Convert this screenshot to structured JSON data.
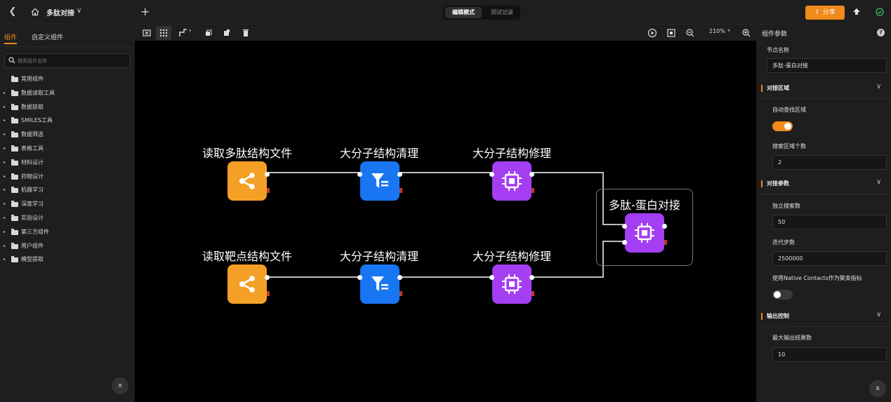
{
  "header": {
    "project_name": "多肽对接",
    "mode_tabs": [
      "编辑模式",
      "测试记录"
    ],
    "share_label": "分享"
  },
  "sidebar": {
    "tabs": [
      "组件",
      "自定义组件"
    ],
    "search_placeholder": "搜索组件名称",
    "items": [
      {
        "label": "常用组件",
        "expandable": false
      },
      {
        "label": "数据读取工具",
        "expandable": true
      },
      {
        "label": "数据获取",
        "expandable": true
      },
      {
        "label": "SMILES工具",
        "expandable": true
      },
      {
        "label": "数据筛选",
        "expandable": true
      },
      {
        "label": "表格工具",
        "expandable": true
      },
      {
        "label": "材料设计",
        "expandable": true
      },
      {
        "label": "药物设计",
        "expandable": true
      },
      {
        "label": "机器学习",
        "expandable": true
      },
      {
        "label": "深度学习",
        "expandable": true
      },
      {
        "label": "实验设计",
        "expandable": true
      },
      {
        "label": "第三方组件",
        "expandable": true
      },
      {
        "label": "用户组件",
        "expandable": true
      },
      {
        "label": "模型提取",
        "expandable": true
      }
    ]
  },
  "canvas": {
    "zoom": "210%",
    "nodes": {
      "read_peptide": "读取多肽结构文件",
      "clean_1": "大分子结构清理",
      "repair_1": "大分子结构修理",
      "read_target": "读取靶点结构文件",
      "clean_2": "大分子结构清理",
      "repair_2": "大分子结构修理",
      "docking": "多肽-蛋白对接"
    },
    "colors": {
      "read": "#f4a026",
      "clean": "#1976f2",
      "repair": "#a43ef2"
    }
  },
  "panel": {
    "title": "组件参数",
    "help": "?",
    "node_name_label": "节点名称",
    "node_name_value": "多肽-蛋白对接",
    "sections": {
      "region": {
        "title": "对接区域",
        "auto_label": "自动查找区域",
        "auto_on": true,
        "count_label": "搜索区域个数",
        "count_value": "2"
      },
      "params": {
        "title": "对接参数",
        "search_label": "独立搜索数",
        "search_value": "50",
        "iter_label": "迭代步数",
        "iter_value": "2500000",
        "native_label": "使用Native Contacts作为聚类指标",
        "native_on": false
      },
      "output": {
        "title": "输出控制",
        "max_label": "最大输出结果数",
        "max_value": "10"
      }
    }
  }
}
